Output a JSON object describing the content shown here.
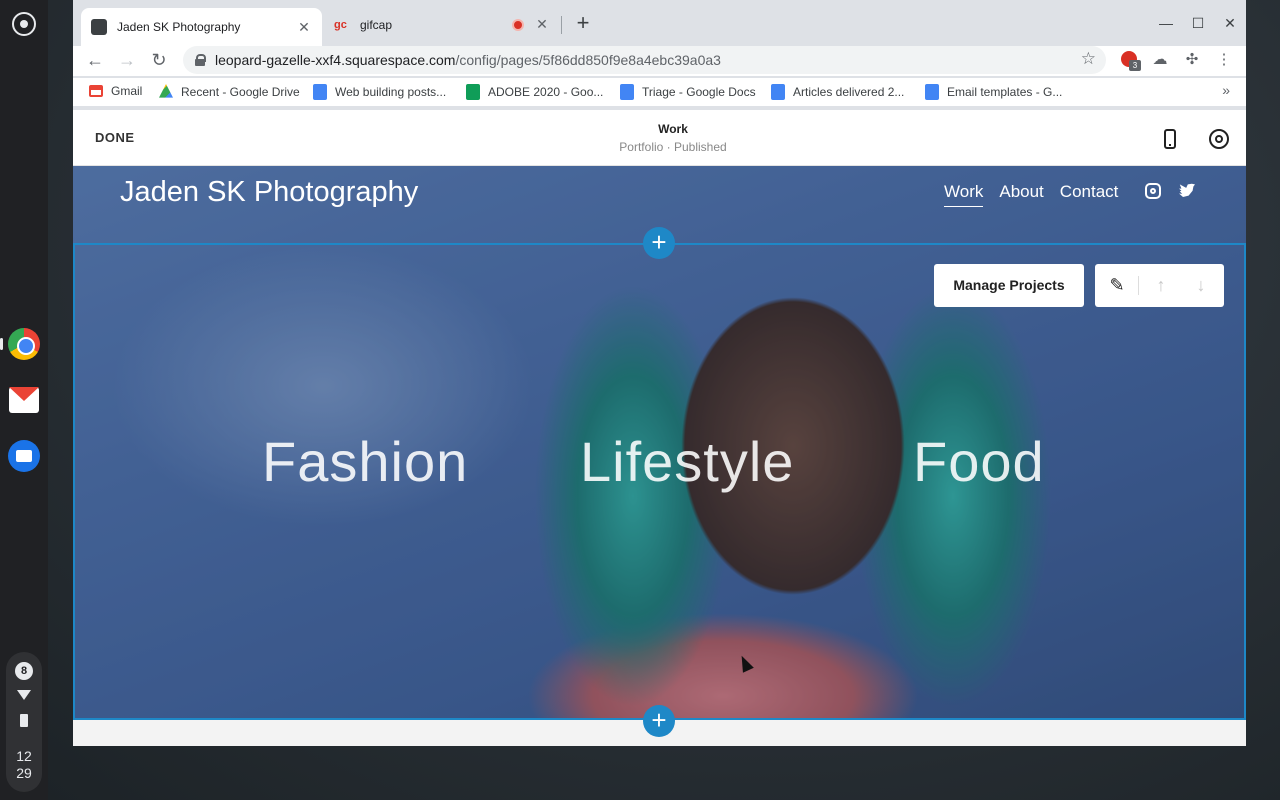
{
  "shelf": {
    "notification_count": "8",
    "clock_hour": "12",
    "clock_minute": "29"
  },
  "browser": {
    "tabs": [
      {
        "title": "Jaden SK Photography",
        "favicon": "squarespace-icon"
      },
      {
        "title": "gifcap",
        "favicon": "gc-icon",
        "badge": "recording-icon"
      }
    ],
    "url_host": "leopard-gazelle-xxf4.squarespace.com",
    "url_path": "/config/pages/5f86dd850f9e8a4ebc39a0a3",
    "extension_badge": "3",
    "bookmarks": [
      {
        "label": "Gmail",
        "icon": "gmail"
      },
      {
        "label": "Recent - Google Drive",
        "icon": "drive"
      },
      {
        "label": "Web building posts...",
        "icon": "doc"
      },
      {
        "label": "ADOBE 2020 - Goo...",
        "icon": "sheet"
      },
      {
        "label": "Triage - Google Docs",
        "icon": "doc"
      },
      {
        "label": "Articles delivered 2...",
        "icon": "doc"
      },
      {
        "label": "Email templates - G...",
        "icon": "doc"
      }
    ]
  },
  "editor": {
    "done_label": "DONE",
    "page_name": "Work",
    "page_status": "Portfolio · Published",
    "manage_projects_label": "Manage Projects"
  },
  "site": {
    "title": "Jaden SK Photography",
    "nav": [
      "Work",
      "About",
      "Contact"
    ],
    "categories": [
      "Fashion",
      "Lifestyle",
      "Food"
    ]
  },
  "colors": {
    "accent": "#1e88c7"
  }
}
